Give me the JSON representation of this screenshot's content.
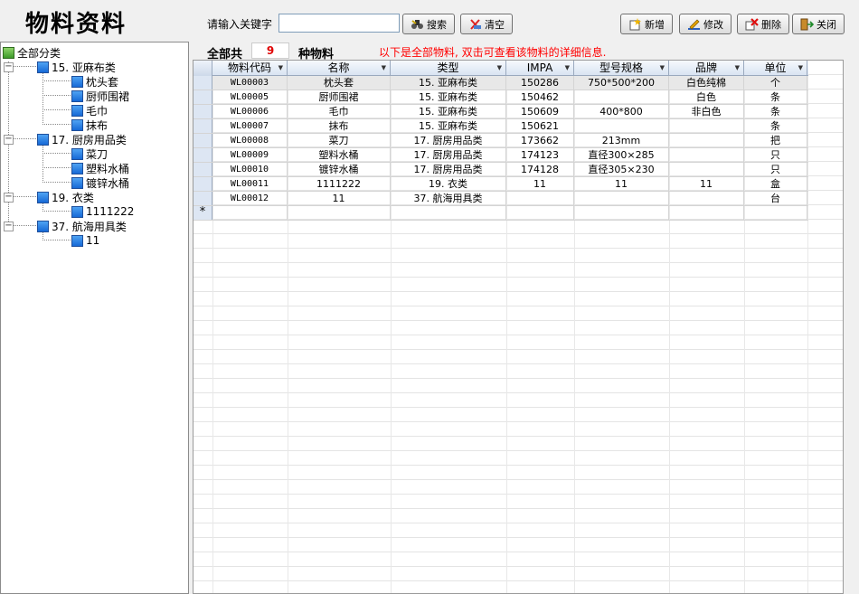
{
  "app_title": "物料资料",
  "search": {
    "label": "请输入关键字",
    "value": "",
    "placeholder": ""
  },
  "buttons": {
    "search": "搜索",
    "clear": "清空",
    "add": "新增",
    "edit": "修改",
    "delete": "删除",
    "close": "关闭"
  },
  "tree": {
    "root": "全部分类",
    "categories": [
      {
        "label": "15. 亚麻布类",
        "items": [
          "枕头套",
          "厨师围裙",
          "毛巾",
          "抹布"
        ]
      },
      {
        "label": "17. 厨房用品类",
        "items": [
          "菜刀",
          "塑料水桶",
          "镀锌水桶"
        ]
      },
      {
        "label": "19. 衣类",
        "items": [
          "1111222"
        ]
      },
      {
        "label": "37. 航海用具类",
        "items": [
          "11"
        ]
      }
    ]
  },
  "info": {
    "prefix": "全部共",
    "count": "9",
    "suffix": "种物料",
    "hint": "以下是全部物料, 双击可查看该物料的详细信息."
  },
  "grid": {
    "columns": [
      "物料代码",
      "名称",
      "类型",
      "IMPA",
      "型号规格",
      "品牌",
      "单位"
    ],
    "rows": [
      [
        "WL00003",
        "枕头套",
        "15. 亚麻布类",
        "150286",
        "750*500*200",
        "白色纯棉",
        "个"
      ],
      [
        "WL00005",
        "厨师围裙",
        "15. 亚麻布类",
        "150462",
        "",
        "白色",
        "条"
      ],
      [
        "WL00006",
        "毛巾",
        "15. 亚麻布类",
        "150609",
        "400*800",
        "非白色",
        "条"
      ],
      [
        "WL00007",
        "抹布",
        "15. 亚麻布类",
        "150621",
        "",
        "",
        "条"
      ],
      [
        "WL00008",
        "菜刀",
        "17. 厨房用品类",
        "173662",
        "213mm",
        "",
        "把"
      ],
      [
        "WL00009",
        "塑料水桶",
        "17. 厨房用品类",
        "174123",
        "直径300×285",
        "",
        "只"
      ],
      [
        "WL00010",
        "镀锌水桶",
        "17. 厨房用品类",
        "174128",
        "直径305×230",
        "",
        "只"
      ],
      [
        "WL00011",
        "1111222",
        "19. 衣类",
        "11",
        "11",
        "11",
        "盒"
      ],
      [
        "WL00012",
        "11",
        "37. 航海用具类",
        "",
        "",
        "",
        "台"
      ]
    ],
    "new_row_marker": "*",
    "sort_arrow": "▼",
    "selected_row_index": 0
  },
  "icons": {
    "search": "binoculars-icon",
    "clear": "eraser-icon",
    "add": "new-document-icon",
    "edit": "edit-pencil-icon",
    "delete": "delete-icon",
    "close": "exit-door-icon"
  }
}
